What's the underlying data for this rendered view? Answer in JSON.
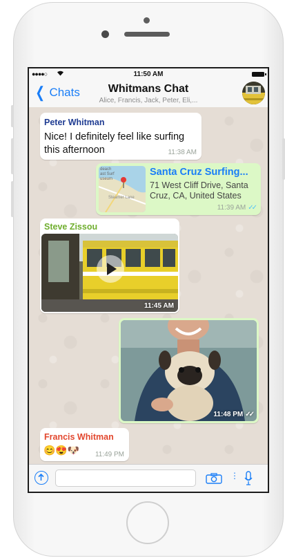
{
  "status_bar": {
    "time": "11:50 AM",
    "signal": "●●●●○"
  },
  "nav": {
    "back_label": "Chats",
    "title": "Whitmans Chat",
    "subtitle": "Alice, Francis, Jack, Peter, Eli,..."
  },
  "messages": [
    {
      "sender": "Peter Whitman",
      "sender_color": "#1f3c92",
      "text": "Nice! I definitely feel like surfing this afternoon",
      "time": "11:38 AM"
    },
    {
      "title": "Santa Cruz Surfing...",
      "address": "71 West Cliff Drive, Santa Cruz, CA, United States",
      "time": "11:39 AM",
      "map_labels": [
        "deach",
        "ast Surf",
        "useum",
        "Steamer Lane"
      ]
    },
    {
      "sender": "Steve Zissou",
      "sender_color": "#6fae2e",
      "time": "11:45 AM"
    },
    {
      "time": "11:48 PM"
    },
    {
      "sender": "Francis Whitman",
      "sender_color": "#e2472e",
      "emoji": "😊😍🐶",
      "time": "11:49 PM"
    }
  ],
  "colors": {
    "accent": "#1a7ef7",
    "outgoing_bubble": "#dcf8c6",
    "read_ticks": "#4fc3f7"
  }
}
